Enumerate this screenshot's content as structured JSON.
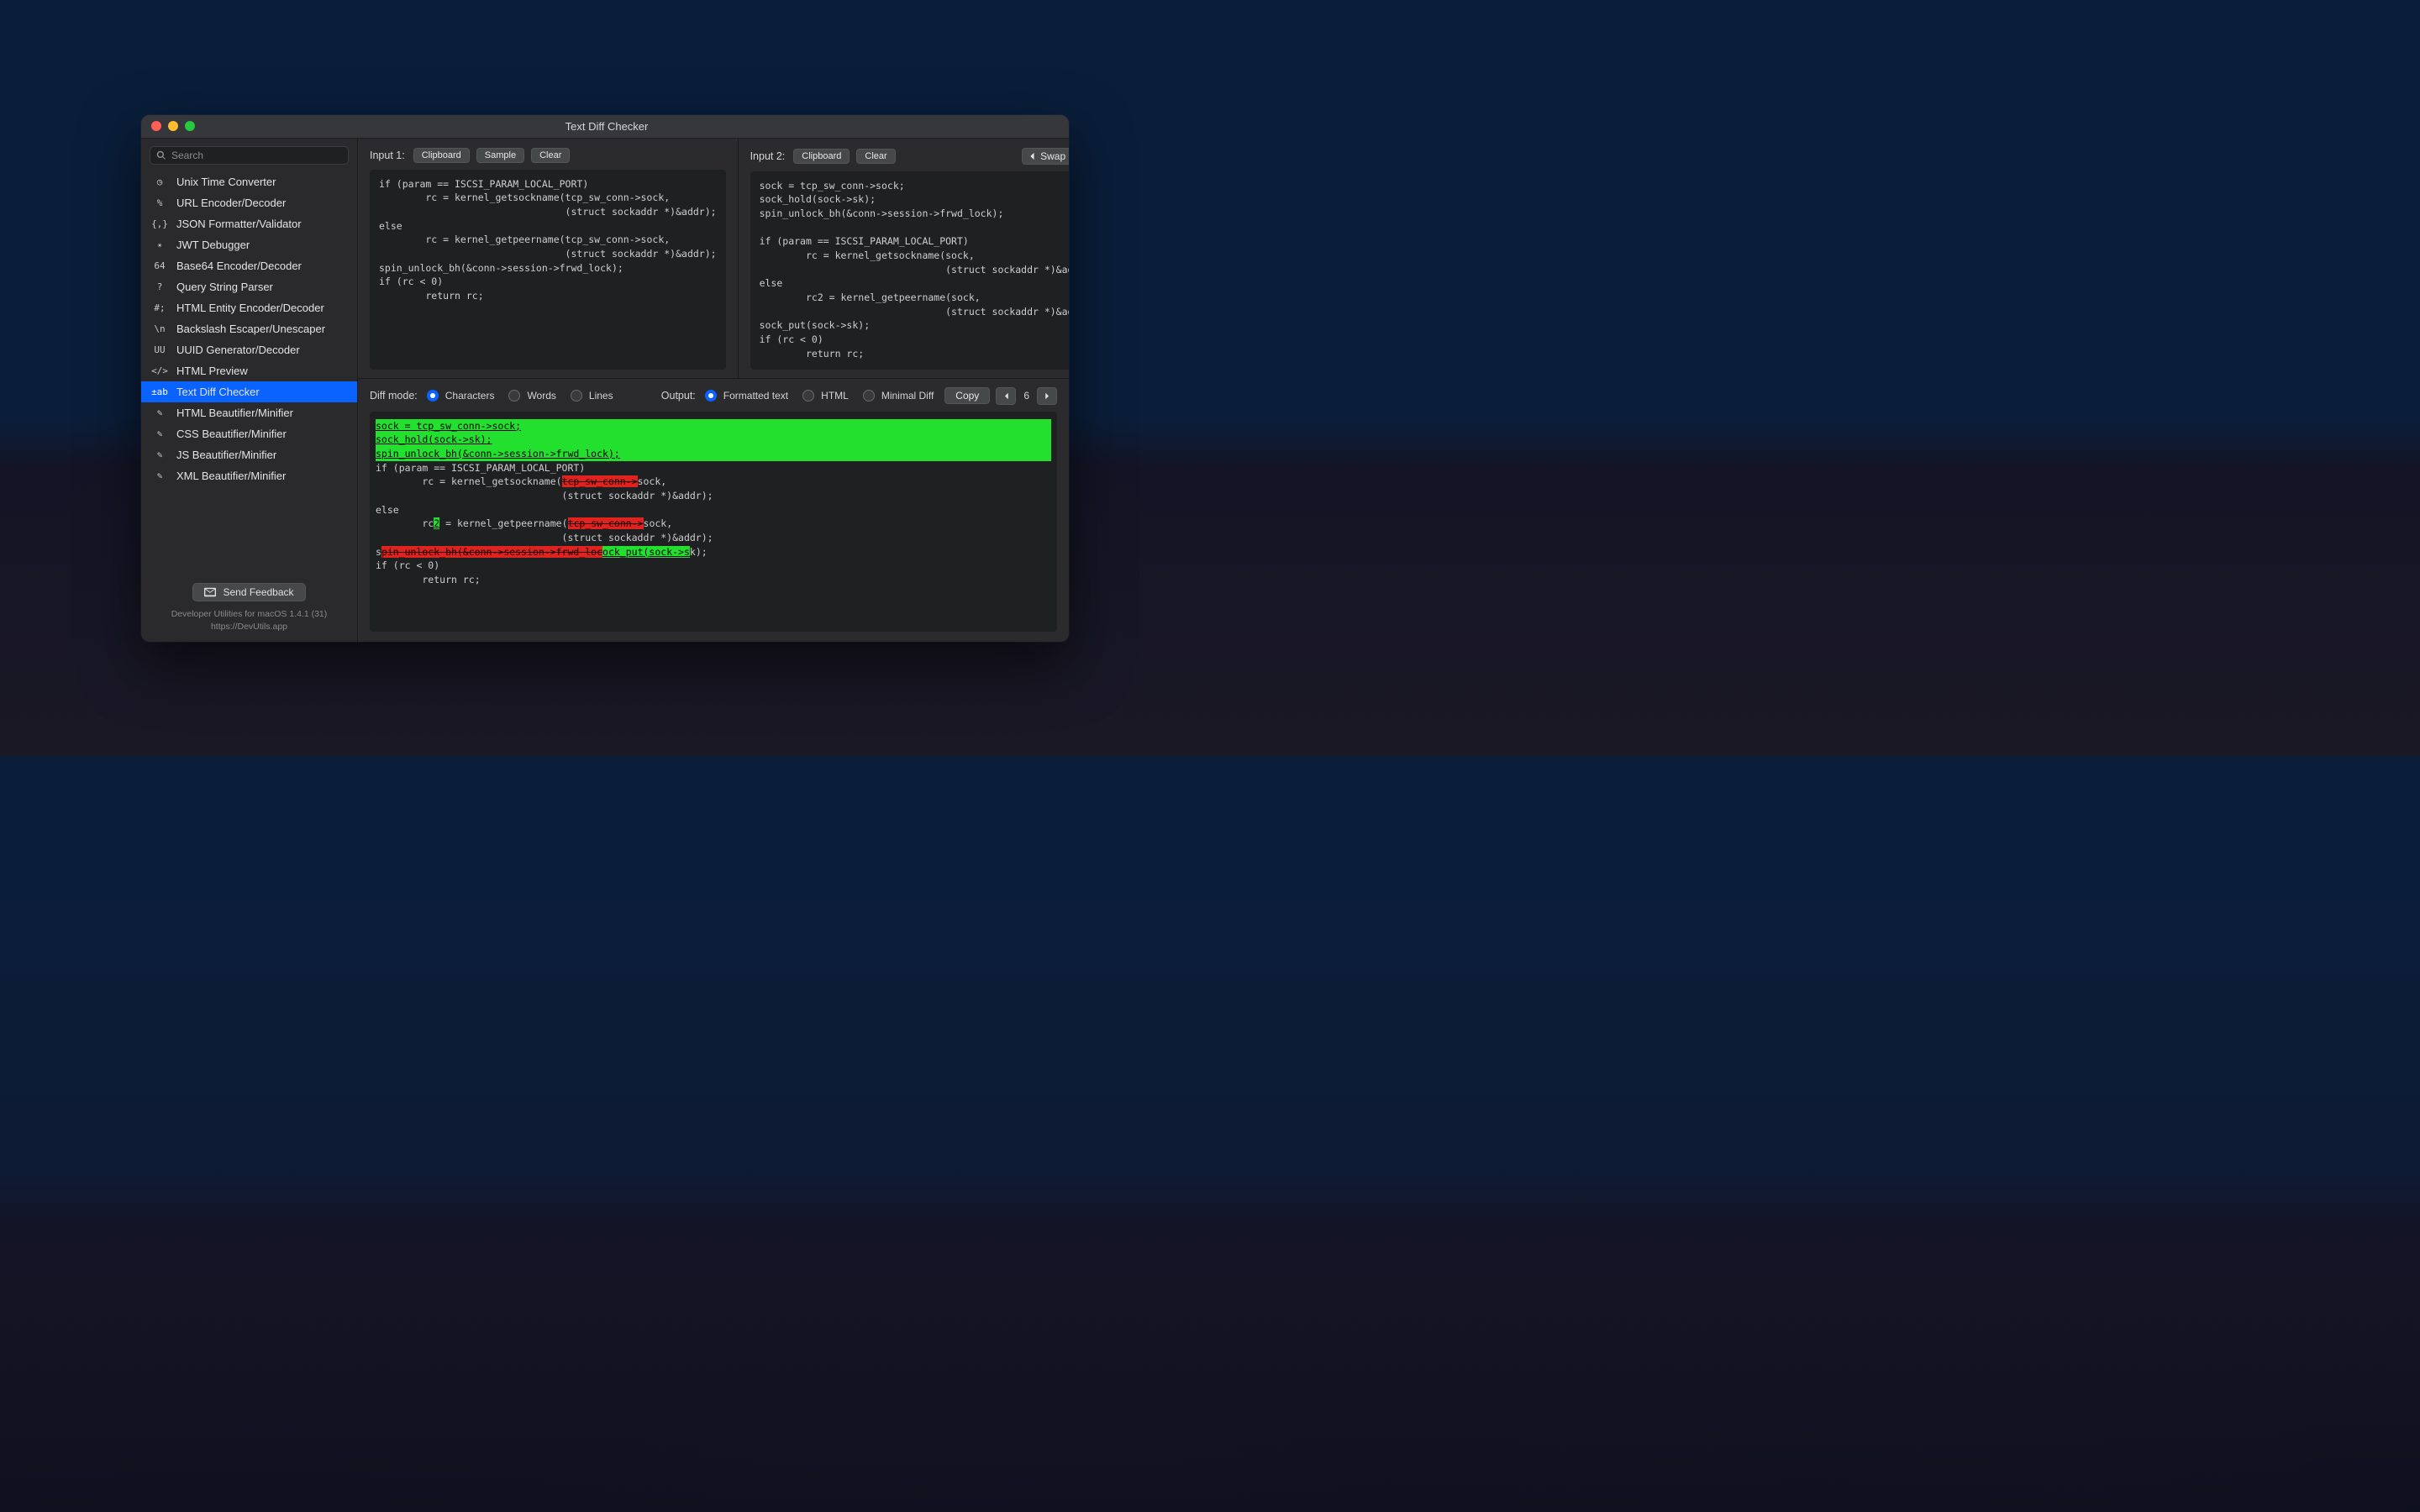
{
  "window": {
    "title": "Text Diff Checker"
  },
  "search": {
    "placeholder": "Search"
  },
  "nav": {
    "items": [
      {
        "id": "unix-time",
        "icon": "◷",
        "label": "Unix Time Converter"
      },
      {
        "id": "url-encoder",
        "icon": "%",
        "label": "URL Encoder/Decoder"
      },
      {
        "id": "json-formatter",
        "icon": "{,}",
        "label": "JSON Formatter/Validator"
      },
      {
        "id": "jwt-debugger",
        "icon": "✴",
        "label": "JWT Debugger"
      },
      {
        "id": "base64",
        "icon": "64",
        "label": "Base64 Encoder/Decoder"
      },
      {
        "id": "query-string",
        "icon": "?",
        "label": "Query String Parser"
      },
      {
        "id": "html-entity",
        "icon": "#;",
        "label": "HTML Entity Encoder/Decoder"
      },
      {
        "id": "backslash",
        "icon": "\\n",
        "label": "Backslash Escaper/Unescaper"
      },
      {
        "id": "uuid",
        "icon": "UU",
        "label": "UUID Generator/Decoder"
      },
      {
        "id": "html-preview",
        "icon": "</>",
        "label": "HTML Preview"
      },
      {
        "id": "text-diff",
        "icon": "±ab",
        "label": "Text Diff Checker",
        "active": true
      },
      {
        "id": "html-beautifier",
        "icon": "✎",
        "label": "HTML Beautifier/Minifier"
      },
      {
        "id": "css-beautifier",
        "icon": "✎",
        "label": "CSS Beautifier/Minifier"
      },
      {
        "id": "js-beautifier",
        "icon": "✎",
        "label": "JS Beautifier/Minifier"
      },
      {
        "id": "xml-beautifier",
        "icon": "✎",
        "label": "XML Beautifier/Minifier"
      }
    ]
  },
  "footer": {
    "feedback_label": "Send Feedback",
    "credit_line1": "Developer Utilities for macOS 1.4.1 (31)",
    "credit_line2": "https://DevUtils.app"
  },
  "input1": {
    "label": "Input 1:",
    "buttons": {
      "clipboard": "Clipboard",
      "sample": "Sample",
      "clear": "Clear"
    },
    "text": "if (param == ISCSI_PARAM_LOCAL_PORT)\n        rc = kernel_getsockname(tcp_sw_conn->sock,\n                                (struct sockaddr *)&addr);\nelse\n        rc = kernel_getpeername(tcp_sw_conn->sock,\n                                (struct sockaddr *)&addr);\nspin_unlock_bh(&conn->session->frwd_lock);\nif (rc < 0)\n        return rc;"
  },
  "input2": {
    "label": "Input 2:",
    "buttons": {
      "clipboard": "Clipboard",
      "clear": "Clear"
    },
    "swap_label": "Swap Inputs",
    "text": "sock = tcp_sw_conn->sock;\nsock_hold(sock->sk);\nspin_unlock_bh(&conn->session->frwd_lock);\n\nif (param == ISCSI_PARAM_LOCAL_PORT)\n        rc = kernel_getsockname(sock,\n                                (struct sockaddr *)&addr);\nelse\n        rc2 = kernel_getpeername(sock,\n                                (struct sockaddr *)&addr);\nsock_put(sock->sk);\nif (rc < 0)\n        return rc;"
  },
  "diff": {
    "mode_label": "Diff mode:",
    "modes": {
      "characters": "Characters",
      "words": "Words",
      "lines": "Lines"
    },
    "selected_mode": "characters",
    "output_label": "Output:",
    "outputs": {
      "formatted": "Formatted text",
      "html": "HTML",
      "minimal": "Minimal Diff"
    },
    "selected_output": "formatted",
    "copy_label": "Copy",
    "diff_count": "6",
    "result_segments": [
      {
        "t": "ins",
        "block": true,
        "v": "sock = tcp_sw_conn->sock;"
      },
      {
        "t": "ins",
        "block": true,
        "v": "sock_hold(sock->sk);"
      },
      {
        "t": "ins",
        "block": true,
        "v": "spin_unlock_bh(&conn->session->frwd_lock);"
      },
      {
        "t": "ins",
        "block": true,
        "v": ""
      },
      {
        "t": "eq",
        "v": "if (param == ISCSI_PARAM_LOCAL_PORT)\n        rc = kernel_getsockname("
      },
      {
        "t": "del",
        "v": "tcp_sw_conn->"
      },
      {
        "t": "eq",
        "v": "sock,\n                                (struct sockaddr *)&addr);\nelse\n        rc"
      },
      {
        "t": "ins",
        "v": "2"
      },
      {
        "t": "eq",
        "v": " = kernel_getpeername("
      },
      {
        "t": "del",
        "v": "tcp_sw_conn->"
      },
      {
        "t": "eq",
        "v": "sock,\n                                (struct sockaddr *)&addr);\ns"
      },
      {
        "t": "del",
        "v": "pin_unlock_bh(&conn->session->frwd_loc"
      },
      {
        "t": "ins",
        "v": "ock_put(sock->s"
      },
      {
        "t": "eq",
        "v": "k);\nif (rc < 0)\n        return rc;"
      }
    ]
  }
}
